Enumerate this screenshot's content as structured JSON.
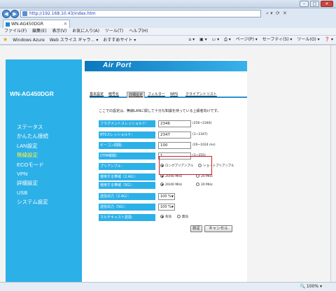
{
  "window": {
    "minimize": "–",
    "maximize": "□",
    "close": "✕"
  },
  "address_bar": {
    "back_icon": "back-arrow-icon",
    "forward_icon": "forward-arrow-icon",
    "url": "http://192.168.10.43/index.htm",
    "tools": [
      "⌕ ▾",
      "⟳",
      "✕"
    ]
  },
  "tabs": [
    {
      "label": "WN-AG450DGR",
      "close": "✕"
    }
  ],
  "menubar": [
    "ファイル(F)",
    "編集(E)",
    "表示(V)",
    "お気に入り(A)",
    "ツール(T)",
    "ヘルプ(H)"
  ],
  "favorites": {
    "items": [
      "Windows Azure",
      "Web スライス ギャラ… ▾",
      "おすすめサイト ▾"
    ],
    "commands": [
      "⌂ ▾",
      "▣ ▾",
      "▭ ▾",
      "⎙ ▾",
      "ページ(P) ▾",
      "セーフティ(S) ▾",
      "ツール(O) ▾",
      "❓ ▾"
    ]
  },
  "sidebar": {
    "product": "WN-AG450DGR",
    "items": [
      {
        "label": "ステータス",
        "active": false
      },
      {
        "label": "かんたん接続",
        "active": false
      },
      {
        "label": "LAN設定",
        "active": false
      },
      {
        "label": "無線設定",
        "active": true
      },
      {
        "label": "ECOモード",
        "active": false
      },
      {
        "label": "VPN",
        "active": false
      },
      {
        "label": "詳細設定",
        "active": false
      },
      {
        "label": "USB",
        "active": false
      },
      {
        "label": "システム設定",
        "active": false
      }
    ]
  },
  "banner": {
    "logo": "Air Port"
  },
  "subtabs": [
    {
      "label": "基本設定",
      "active": false
    },
    {
      "label": "暗号化",
      "active": false
    },
    {
      "label": "詳細設定",
      "active": true
    },
    {
      "label": "フィルター",
      "active": false
    },
    {
      "label": "WPS",
      "active": false
    },
    {
      "label": "クライアントリスト",
      "active": false
    }
  ],
  "description": "ここでの設定は、無線LANに関して十分な知識を持っている上級者向けです。",
  "fields": {
    "fragment": {
      "label": "フラグメントスレッショルド：",
      "value": "2346",
      "hint": "(256~2346)"
    },
    "rts": {
      "label": "RTSスレッショルド：",
      "value": "2347",
      "hint": "(1~2347)"
    },
    "beacon": {
      "label": "ビーコン間隔：",
      "value": "100",
      "hint": "(20~1024 ms)"
    },
    "dtim": {
      "label": "DTIM期間：",
      "value": "1",
      "hint": "(1~255)"
    },
    "preamble": {
      "label": "プリアンブル：",
      "options": [
        "ロングプリアンブル",
        "ショートプリアンブル"
      ],
      "selected": 0
    },
    "band24": {
      "label": "使用する帯域（2.4G）：",
      "options": [
        "20/40 MHz",
        "20 MHz"
      ],
      "selected": 0
    },
    "band5": {
      "label": "使用する帯域（5G）：",
      "options": [
        "20/40 MHz",
        "20 MHz"
      ],
      "selected": 0
    },
    "power24": {
      "label": "送信出力（2.4G）：",
      "value": "100 %"
    },
    "power5": {
      "label": "送信出力（5G）：",
      "value": "100 %"
    },
    "multicast": {
      "label": "マルチキャスト変換：",
      "options": [
        "有効",
        "無効"
      ],
      "selected": 0
    }
  },
  "buttons": {
    "apply": "設定",
    "cancel": "キャンセル"
  },
  "status": {
    "zoom": "🔍 100% ▾"
  },
  "colors": {
    "sidebar": "#2cb0e8",
    "label_bg": "#2cb0e8",
    "highlight": "#c81e2c",
    "active_menu": "#fff13c"
  }
}
